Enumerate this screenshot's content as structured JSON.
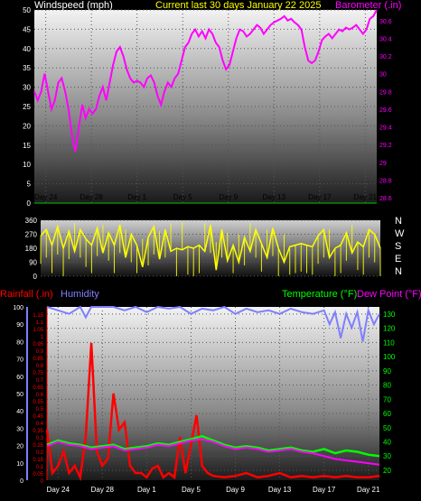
{
  "header": {
    "wind_label": "Windspeed (mph)",
    "title": "Current last 30 days January 22 2025",
    "baro_label": "Barometer (.in)"
  },
  "mid": {
    "compass": [
      "N",
      "W",
      "S",
      "E",
      "N"
    ]
  },
  "bottom": {
    "rain_label": "Rainfall (.in)",
    "hum_label": "Humidity",
    "temp_label": "Temperature (°F)",
    "dew_label": "Dew Point (°F)"
  },
  "colors": {
    "wind": "#ffffff",
    "barometer": "#ff00ff",
    "direction": "#ffff00",
    "rainfall": "#ff0000",
    "humidity": "#7f7fff",
    "temperature": "#00ff00",
    "dewpoint": "#ff00ff"
  },
  "chart_data": [
    {
      "type": "line",
      "title": "Current last 30 days January 22 2025",
      "x_ticks": [
        "Day 24",
        "Day 28",
        "Day 1",
        "Day 5",
        "Day 9",
        "Day 13",
        "Day 17",
        "Day 21"
      ],
      "x_range_days": [
        0,
        30
      ],
      "left_axis": {
        "label": "Windspeed (mph)",
        "ticks": [
          0,
          5,
          10,
          15,
          20,
          25,
          30,
          35,
          40,
          45,
          50
        ],
        "ylim": [
          0,
          50
        ]
      },
      "right_axis": {
        "label": "Barometer (.in)",
        "ticks": [
          28.6,
          28.8,
          29,
          29.2,
          29.4,
          29.6,
          29.8,
          30,
          30.2,
          30.4,
          30.6
        ],
        "ylim": [
          28.54,
          30.72
        ]
      },
      "series": [
        {
          "name": "Barometer (.in)",
          "axis": "right",
          "x": [
            0,
            0.3,
            0.6,
            0.9,
            1.2,
            1.5,
            1.8,
            2.1,
            2.4,
            2.7,
            3.0,
            3.3,
            3.6,
            3.9,
            4.2,
            4.5,
            4.8,
            5.1,
            5.4,
            5.7,
            6.0,
            6.3,
            6.6,
            6.9,
            7.2,
            7.5,
            7.8,
            8.1,
            8.4,
            8.7,
            9.0,
            9.3,
            9.6,
            9.9,
            10.2,
            10.5,
            10.8,
            11.1,
            11.4,
            11.7,
            12.0,
            12.3,
            12.6,
            12.9,
            13.2,
            13.5,
            13.8,
            14.1,
            14.4,
            14.7,
            15.0,
            15.3,
            15.6,
            15.9,
            16.2,
            16.5,
            16.8,
            17.1,
            17.4,
            17.7,
            18.0,
            18.3,
            18.6,
            18.9,
            19.2,
            19.5,
            19.8,
            20.1,
            20.4,
            20.7,
            21.0,
            21.3,
            21.6,
            21.9,
            22.2,
            22.5,
            22.8,
            23.1,
            23.4,
            23.7,
            24.0,
            24.3,
            24.6,
            24.9,
            25.2,
            25.5,
            25.8,
            26.1,
            26.4,
            26.7,
            27.0,
            27.3,
            27.6,
            27.9,
            28.2,
            28.5,
            28.8,
            29.1,
            29.4,
            29.7,
            30.0
          ],
          "values": [
            29.8,
            29.7,
            29.8,
            30.0,
            29.8,
            29.6,
            29.7,
            29.9,
            29.95,
            29.8,
            29.6,
            29.3,
            29.12,
            29.4,
            29.65,
            29.5,
            29.6,
            29.55,
            29.6,
            29.75,
            29.85,
            29.7,
            29.9,
            30.1,
            30.25,
            30.3,
            30.2,
            30.05,
            29.95,
            29.9,
            29.92,
            29.9,
            29.85,
            29.95,
            29.98,
            29.9,
            29.75,
            29.65,
            29.8,
            29.9,
            29.85,
            29.95,
            30.0,
            30.15,
            30.3,
            30.35,
            30.45,
            30.5,
            30.42,
            30.48,
            30.4,
            30.5,
            30.45,
            30.35,
            30.3,
            30.15,
            30.05,
            30.1,
            30.25,
            30.4,
            30.5,
            30.48,
            30.42,
            30.45,
            30.5,
            30.55,
            30.52,
            30.45,
            30.5,
            30.55,
            30.58,
            30.6,
            30.62,
            30.65,
            30.6,
            30.62,
            30.58,
            30.55,
            30.5,
            30.3,
            30.15,
            30.12,
            30.15,
            30.25,
            30.38,
            30.42,
            30.45,
            30.4,
            30.45,
            30.5,
            30.48,
            30.52,
            30.5,
            30.52,
            30.55,
            30.5,
            30.45,
            30.5,
            30.62,
            30.65,
            30.72
          ]
        },
        {
          "name": "Windspeed (mph)",
          "axis": "left",
          "x": [
            0,
            30
          ],
          "values": [
            0,
            0
          ]
        }
      ]
    },
    {
      "type": "line",
      "title": "",
      "y_axis": {
        "ticks": [
          0,
          90,
          180,
          270,
          360
        ],
        "ylim": [
          0,
          360
        ]
      },
      "x_range_days": [
        0,
        30
      ],
      "series": [
        {
          "name": "",
          "x": [
            0,
            0.5,
            1,
            1.5,
            2,
            2.5,
            3,
            3.5,
            4,
            4.5,
            5,
            5.5,
            6,
            6.5,
            7,
            7.5,
            8,
            8.5,
            9,
            9.5,
            10,
            10.5,
            11,
            11.5,
            12,
            12.5,
            13,
            13.5,
            14,
            14.5,
            15,
            15.5,
            16,
            16.5,
            17,
            17.5,
            18,
            18.5,
            19,
            19.5,
            20,
            20.5,
            21,
            21.5,
            22,
            22.5,
            23,
            23.5,
            24,
            24.5,
            25,
            25.5,
            26,
            26.5,
            27,
            27.5,
            28,
            28.5,
            29,
            29.5,
            30
          ],
          "values": [
            260,
            300,
            200,
            320,
            180,
            290,
            160,
            300,
            240,
            200,
            310,
            150,
            280,
            200,
            330,
            120,
            270,
            200,
            60,
            250,
            320,
            110,
            300,
            160,
            180,
            170,
            190,
            180,
            200,
            160,
            330,
            40,
            300,
            100,
            200,
            90,
            250,
            160,
            300,
            210,
            120,
            310,
            180,
            90,
            190,
            200,
            210,
            200,
            190,
            260,
            300,
            120,
            180,
            200,
            280,
            150,
            220,
            190,
            300,
            270,
            180
          ]
        }
      ]
    },
    {
      "type": "line",
      "title": "",
      "x_ticks": [
        "Day 24",
        "Day 28",
        "Day 1",
        "Day 5",
        "Day 9",
        "Day 13",
        "Day 17",
        "Day 21"
      ],
      "x_range_days": [
        0,
        30
      ],
      "left_axis_outer": {
        "label": "Humidity",
        "ticks": [
          0,
          10,
          20,
          30,
          40,
          50,
          60,
          70,
          80,
          90,
          100
        ],
        "ylim": [
          0,
          100
        ]
      },
      "left_axis_inner": {
        "label": "Rainfall (.in)",
        "ticks": [
          0,
          0.05,
          0.1,
          0.15,
          0.2,
          0.25,
          0.3,
          0.35,
          0.4,
          0.45,
          0.5,
          0.55,
          0.6,
          0.65,
          0.7,
          0.75,
          0.8,
          0.85,
          0.9,
          0.95,
          1,
          1.05,
          1.1,
          1.15
        ],
        "ylim": [
          0,
          1.2
        ]
      },
      "right_axis": {
        "label": "Temperature (°F)",
        "ticks": [
          20,
          30,
          40,
          50,
          60,
          70,
          80,
          90,
          100,
          110,
          120,
          130
        ],
        "ylim": [
          13,
          135
        ]
      },
      "series": [
        {
          "name": "Humidity",
          "axis": "left_outer",
          "x": [
            0,
            1,
            2,
            3,
            3.5,
            4,
            5,
            6,
            7,
            8,
            9,
            10,
            11,
            12,
            13,
            14,
            15,
            16,
            17,
            18,
            19,
            20,
            21,
            22,
            23,
            24,
            25,
            25.5,
            26,
            26.5,
            27,
            27.5,
            28,
            28.5,
            29,
            29.5,
            30
          ],
          "values": [
            100,
            98,
            96,
            100,
            94,
            100,
            100,
            100,
            98,
            100,
            97,
            100,
            99,
            100,
            96,
            99,
            98,
            100,
            96,
            99,
            97,
            98,
            96,
            99,
            97,
            96,
            98,
            90,
            97,
            82,
            96,
            88,
            97,
            80,
            98,
            90,
            96
          ]
        },
        {
          "name": "Rainfall (.in)",
          "axis": "left_inner",
          "x": [
            0,
            0.5,
            1,
            1.5,
            2,
            2.5,
            3,
            3.5,
            4,
            4.5,
            5,
            5.5,
            6,
            6.5,
            7,
            7.5,
            8,
            8.5,
            9,
            9.5,
            10,
            10.5,
            11,
            11.5,
            12,
            12.5,
            13,
            13.5,
            14,
            14.5,
            15,
            16,
            17,
            18,
            19,
            20,
            21,
            22,
            23,
            24,
            25,
            26,
            27,
            28,
            29,
            30
          ],
          "values": [
            0.35,
            0.05,
            0.1,
            0.2,
            0.05,
            0.1,
            0.02,
            0.3,
            0.95,
            0.2,
            0.1,
            0.15,
            0.6,
            0.35,
            0.4,
            0.1,
            0.05,
            0.05,
            0.02,
            0.08,
            0.1,
            0.02,
            0.05,
            0.02,
            0.3,
            0.05,
            0.25,
            0.45,
            0.1,
            0.05,
            0.03,
            0.02,
            0.03,
            0.05,
            0.02,
            0.03,
            0.05,
            0.02,
            0.03,
            0.02,
            0.03,
            0.02,
            0.03,
            0.02,
            0.02,
            0.03
          ]
        },
        {
          "name": "Temperature (°F)",
          "axis": "right",
          "x": [
            0,
            1,
            2,
            3,
            4,
            5,
            6,
            7,
            8,
            9,
            10,
            11,
            12,
            13,
            14,
            15,
            16,
            17,
            18,
            19,
            20,
            21,
            22,
            23,
            24,
            25,
            26,
            27,
            28,
            29,
            30
          ],
          "values": [
            38,
            41,
            39,
            38,
            36,
            37,
            38,
            35,
            36,
            37,
            39,
            38,
            40,
            42,
            44,
            41,
            38,
            36,
            37,
            36,
            34,
            35,
            36,
            34,
            33,
            35,
            32,
            34,
            33,
            31,
            30
          ]
        },
        {
          "name": "Dew Point (°F)",
          "axis": "right",
          "x": [
            0,
            1,
            2,
            3,
            4,
            5,
            6,
            7,
            8,
            9,
            10,
            11,
            12,
            13,
            14,
            15,
            16,
            17,
            18,
            19,
            20,
            21,
            22,
            23,
            24,
            25,
            26,
            27,
            28,
            29,
            30
          ],
          "values": [
            37,
            40,
            38,
            37,
            35,
            36,
            37,
            34,
            35,
            36,
            38,
            37,
            39,
            41,
            42,
            40,
            37,
            35,
            36,
            35,
            33,
            34,
            35,
            33,
            32,
            30,
            28,
            27,
            26,
            25,
            24
          ]
        }
      ]
    }
  ]
}
